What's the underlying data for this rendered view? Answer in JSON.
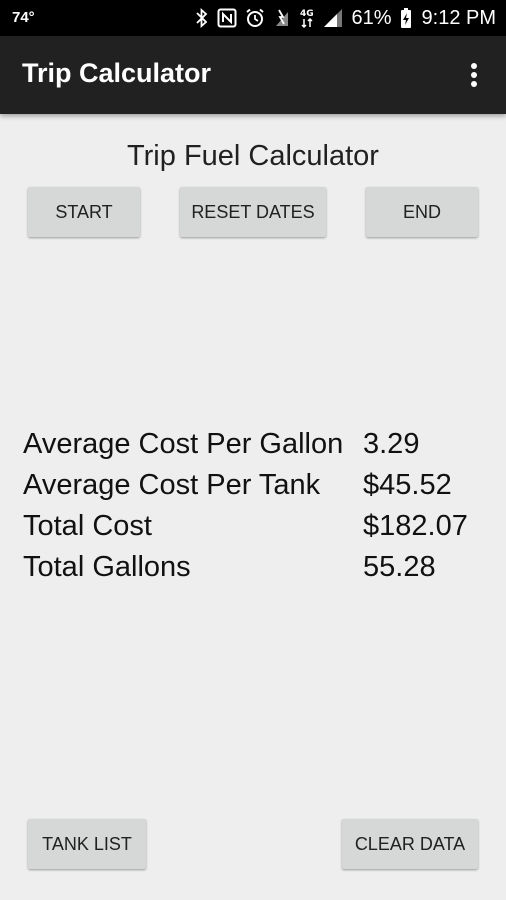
{
  "status_bar": {
    "temperature": "74°",
    "battery_percent": "61%",
    "time": "9:12 PM",
    "icons": [
      "bluetooth-icon",
      "nfc-icon",
      "alarm-icon",
      "data-saver-icon",
      "4g-lte-icon",
      "signal-icon",
      "battery-charging-icon"
    ]
  },
  "app_bar": {
    "title": "Trip Calculator",
    "menu_icon": "more-vert-icon"
  },
  "main": {
    "title": "Trip Fuel Calculator",
    "buttons": {
      "start": "START",
      "reset_dates": "RESET DATES",
      "end": "END"
    },
    "stats": [
      {
        "label": "Average Cost Per Gallon",
        "value": "3.29"
      },
      {
        "label": "Average Cost Per Tank",
        "value": "$45.52"
      },
      {
        "label": "Total Cost",
        "value": "$182.07"
      },
      {
        "label": "Total Gallons",
        "value": "55.28"
      }
    ]
  },
  "footer": {
    "tank_list": "TANK LIST",
    "clear_data": "CLEAR DATA"
  },
  "colors": {
    "background": "#eeeeee",
    "app_bar": "#212121",
    "status_bar": "#000000",
    "button": "#d6d7d7"
  }
}
